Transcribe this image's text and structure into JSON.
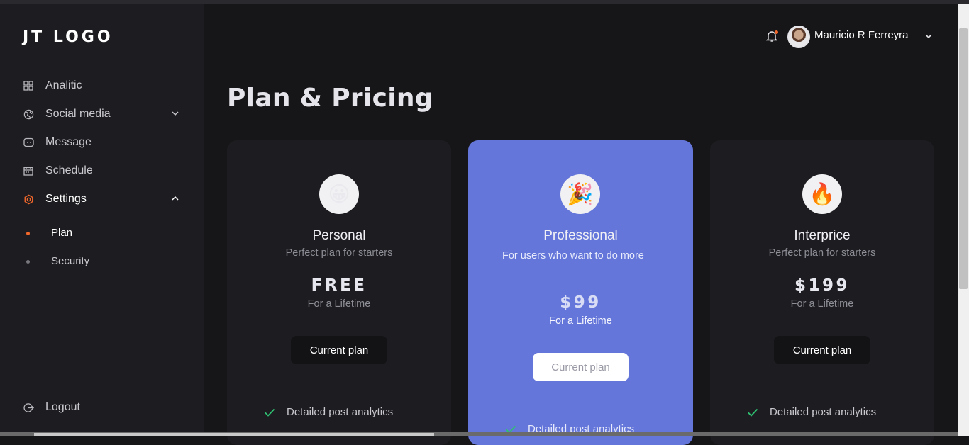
{
  "brand": {
    "logo_text": "JT LOGO"
  },
  "sidebar": {
    "items": [
      {
        "label": "Analitic",
        "icon": "dashboard-icon"
      },
      {
        "label": "Social media",
        "icon": "globe-icon",
        "chevron": "chevron-down-icon"
      },
      {
        "label": "Message",
        "icon": "message-icon"
      },
      {
        "label": "Schedule",
        "icon": "calendar-icon"
      },
      {
        "label": "Settings",
        "icon": "gear-icon",
        "chevron": "chevron-up-icon",
        "active": true
      }
    ],
    "subitems": [
      {
        "label": "Plan",
        "active": true
      },
      {
        "label": "Security",
        "active": false
      }
    ],
    "logout_label": "Logout"
  },
  "header": {
    "username": "Mauricio R Ferreyra",
    "notification_icon": "bell-icon"
  },
  "page": {
    "title": "Plan & Pricing"
  },
  "plans": [
    {
      "name": "Personal",
      "emoji": "😀",
      "description": "Perfect plan for starters",
      "price": "FREE",
      "period": "For a Lifetime",
      "button": "Current plan",
      "feature": "Detailed post analytics"
    },
    {
      "name": "Professional",
      "emoji": "🎉",
      "description": "For users who want to do more",
      "price": "$99",
      "period": "For a Lifetime",
      "button": "Current plan",
      "feature": "Detailed post analytics"
    },
    {
      "name": "Interprice",
      "emoji": "🔥",
      "description": "Perfect plan for starters",
      "price": "$199",
      "period": "For a Lifetime",
      "button": "Current plan",
      "feature": "Detailed post analytics"
    }
  ],
  "colors": {
    "accent": "#f2672a",
    "highlight_card": "#6476d9",
    "check": "#2fbf71"
  }
}
